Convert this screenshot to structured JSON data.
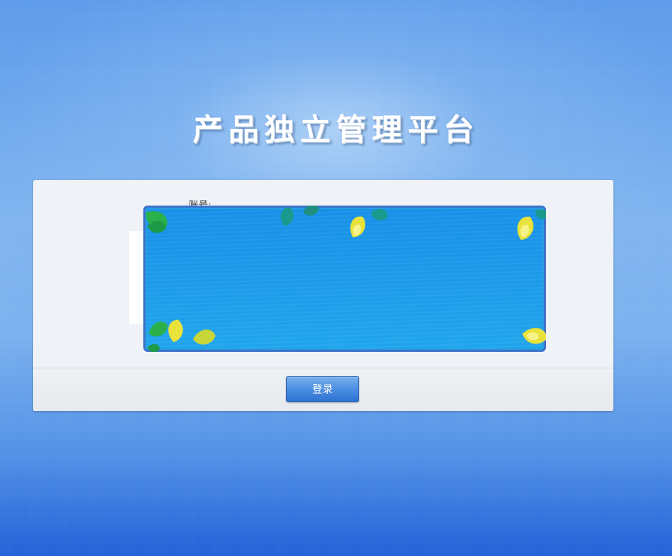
{
  "page": {
    "title": "产品独立管理平台"
  },
  "form": {
    "account_label": "账号:",
    "login_button": "登录"
  },
  "colors": {
    "background_top": "#5b9aea",
    "background_bottom": "#1f5fd8",
    "panel": "#eff2f6",
    "banner": "#1c9aea",
    "button": "#4b8ee1"
  },
  "icons": {
    "banner_decoration": "leaf-icon"
  }
}
